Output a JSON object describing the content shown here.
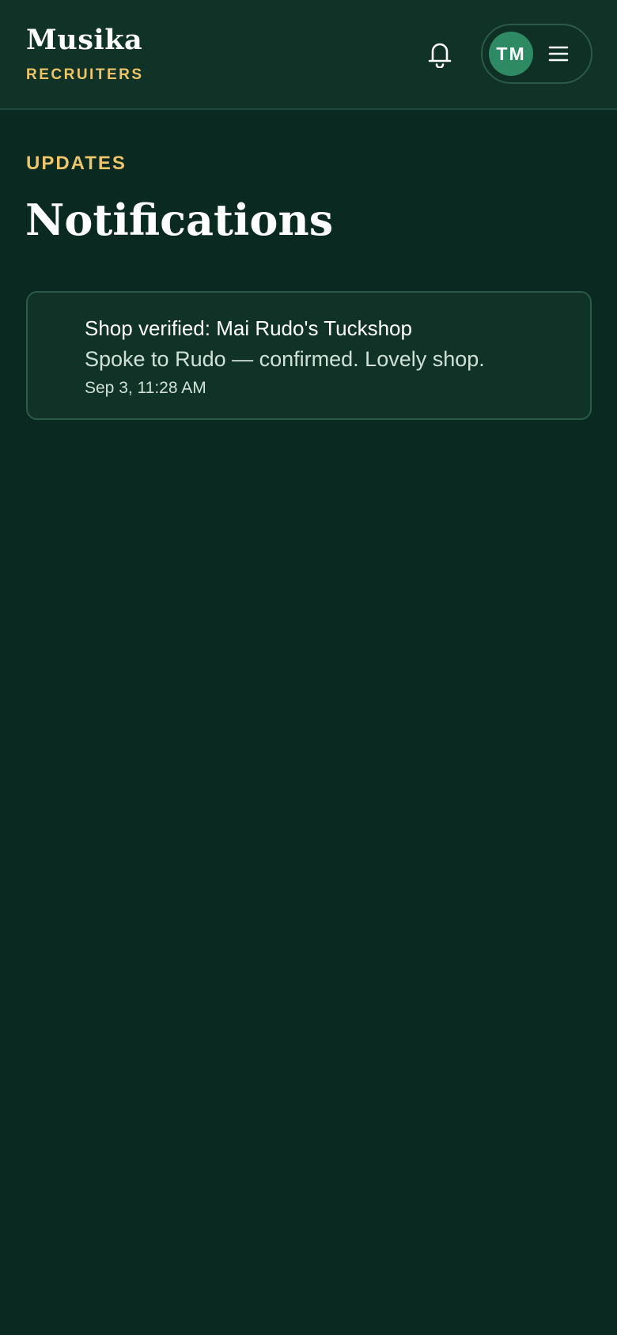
{
  "header": {
    "brand_title": "Musika",
    "brand_subtitle": "RECRUITERS",
    "notifications_icon": "bell-icon",
    "user": {
      "initials": "TM",
      "avatar_color": "#2e8a63",
      "menu_icon": "hamburger-menu-icon"
    }
  },
  "page": {
    "eyebrow": "UPDATES",
    "title": "Notifications"
  },
  "notifications": [
    {
      "title": "Shop verified: Mai Rudo's Tuckshop",
      "body": "Spoke to Rudo — confirmed. Lovely shop.",
      "time": "Sep 3, 11:28 AM"
    }
  ],
  "colors": {
    "background": "#0a2920",
    "header_background": "#113327",
    "accent_gold": "#ecc46a",
    "card_border": "#2b5a48"
  }
}
